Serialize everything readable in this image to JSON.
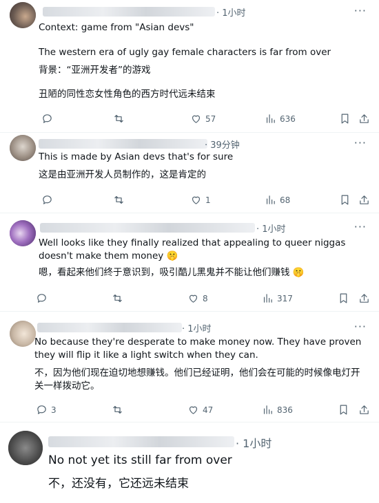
{
  "posts": [
    {
      "time": "· 1小时",
      "lines": [
        "Context: game from \"Asian devs\"",
        "The western era of ugly gay female characters is far from over",
        "背景：“亚洲开发者”的游戏",
        "丑陋的同性恋女性角色的西方时代远未结束"
      ],
      "stats": {
        "replies": "",
        "reposts": "",
        "likes": "57",
        "views": "636"
      }
    },
    {
      "time": "· 39分钟",
      "lines": [
        "This is made by Asian devs that's for sure",
        "这是由亚洲开发人员制作的，这是肯定的"
      ],
      "stats": {
        "replies": "",
        "reposts": "",
        "likes": "1",
        "views": "68"
      }
    },
    {
      "time": "· 1小时",
      "lines": [
        "Well looks like they finally realized that appealing to queer niggas doesn't make them money 🤫",
        "嗯，看起来他们终于意识到，吸引酷儿黑鬼并不能让他们赚钱 🤫"
      ],
      "stats": {
        "replies": "",
        "reposts": "",
        "likes": "8",
        "views": "317"
      }
    },
    {
      "time": "· 1小时",
      "lines": [
        "No because they're desperate to make money now. They have proven they will flip it like a light switch when they can.",
        "不，因为他们现在迫切地想赚钱。他们已经证明，他们会在可能的时候像电灯开关一样拨动它。"
      ],
      "stats": {
        "replies": "3",
        "reposts": "",
        "likes": "47",
        "views": "836"
      }
    },
    {
      "time": "· 1小时",
      "lines": [
        "No not yet its still far from over",
        "不，还没有，它还远未结束"
      ]
    }
  ],
  "icons": {
    "reply": "reply-icon",
    "repost": "repost-icon",
    "like": "heart-icon",
    "views": "views-icon",
    "bookmark": "bookmark-icon",
    "share": "share-icon",
    "more": "more-icon"
  },
  "more_glyph": "···"
}
